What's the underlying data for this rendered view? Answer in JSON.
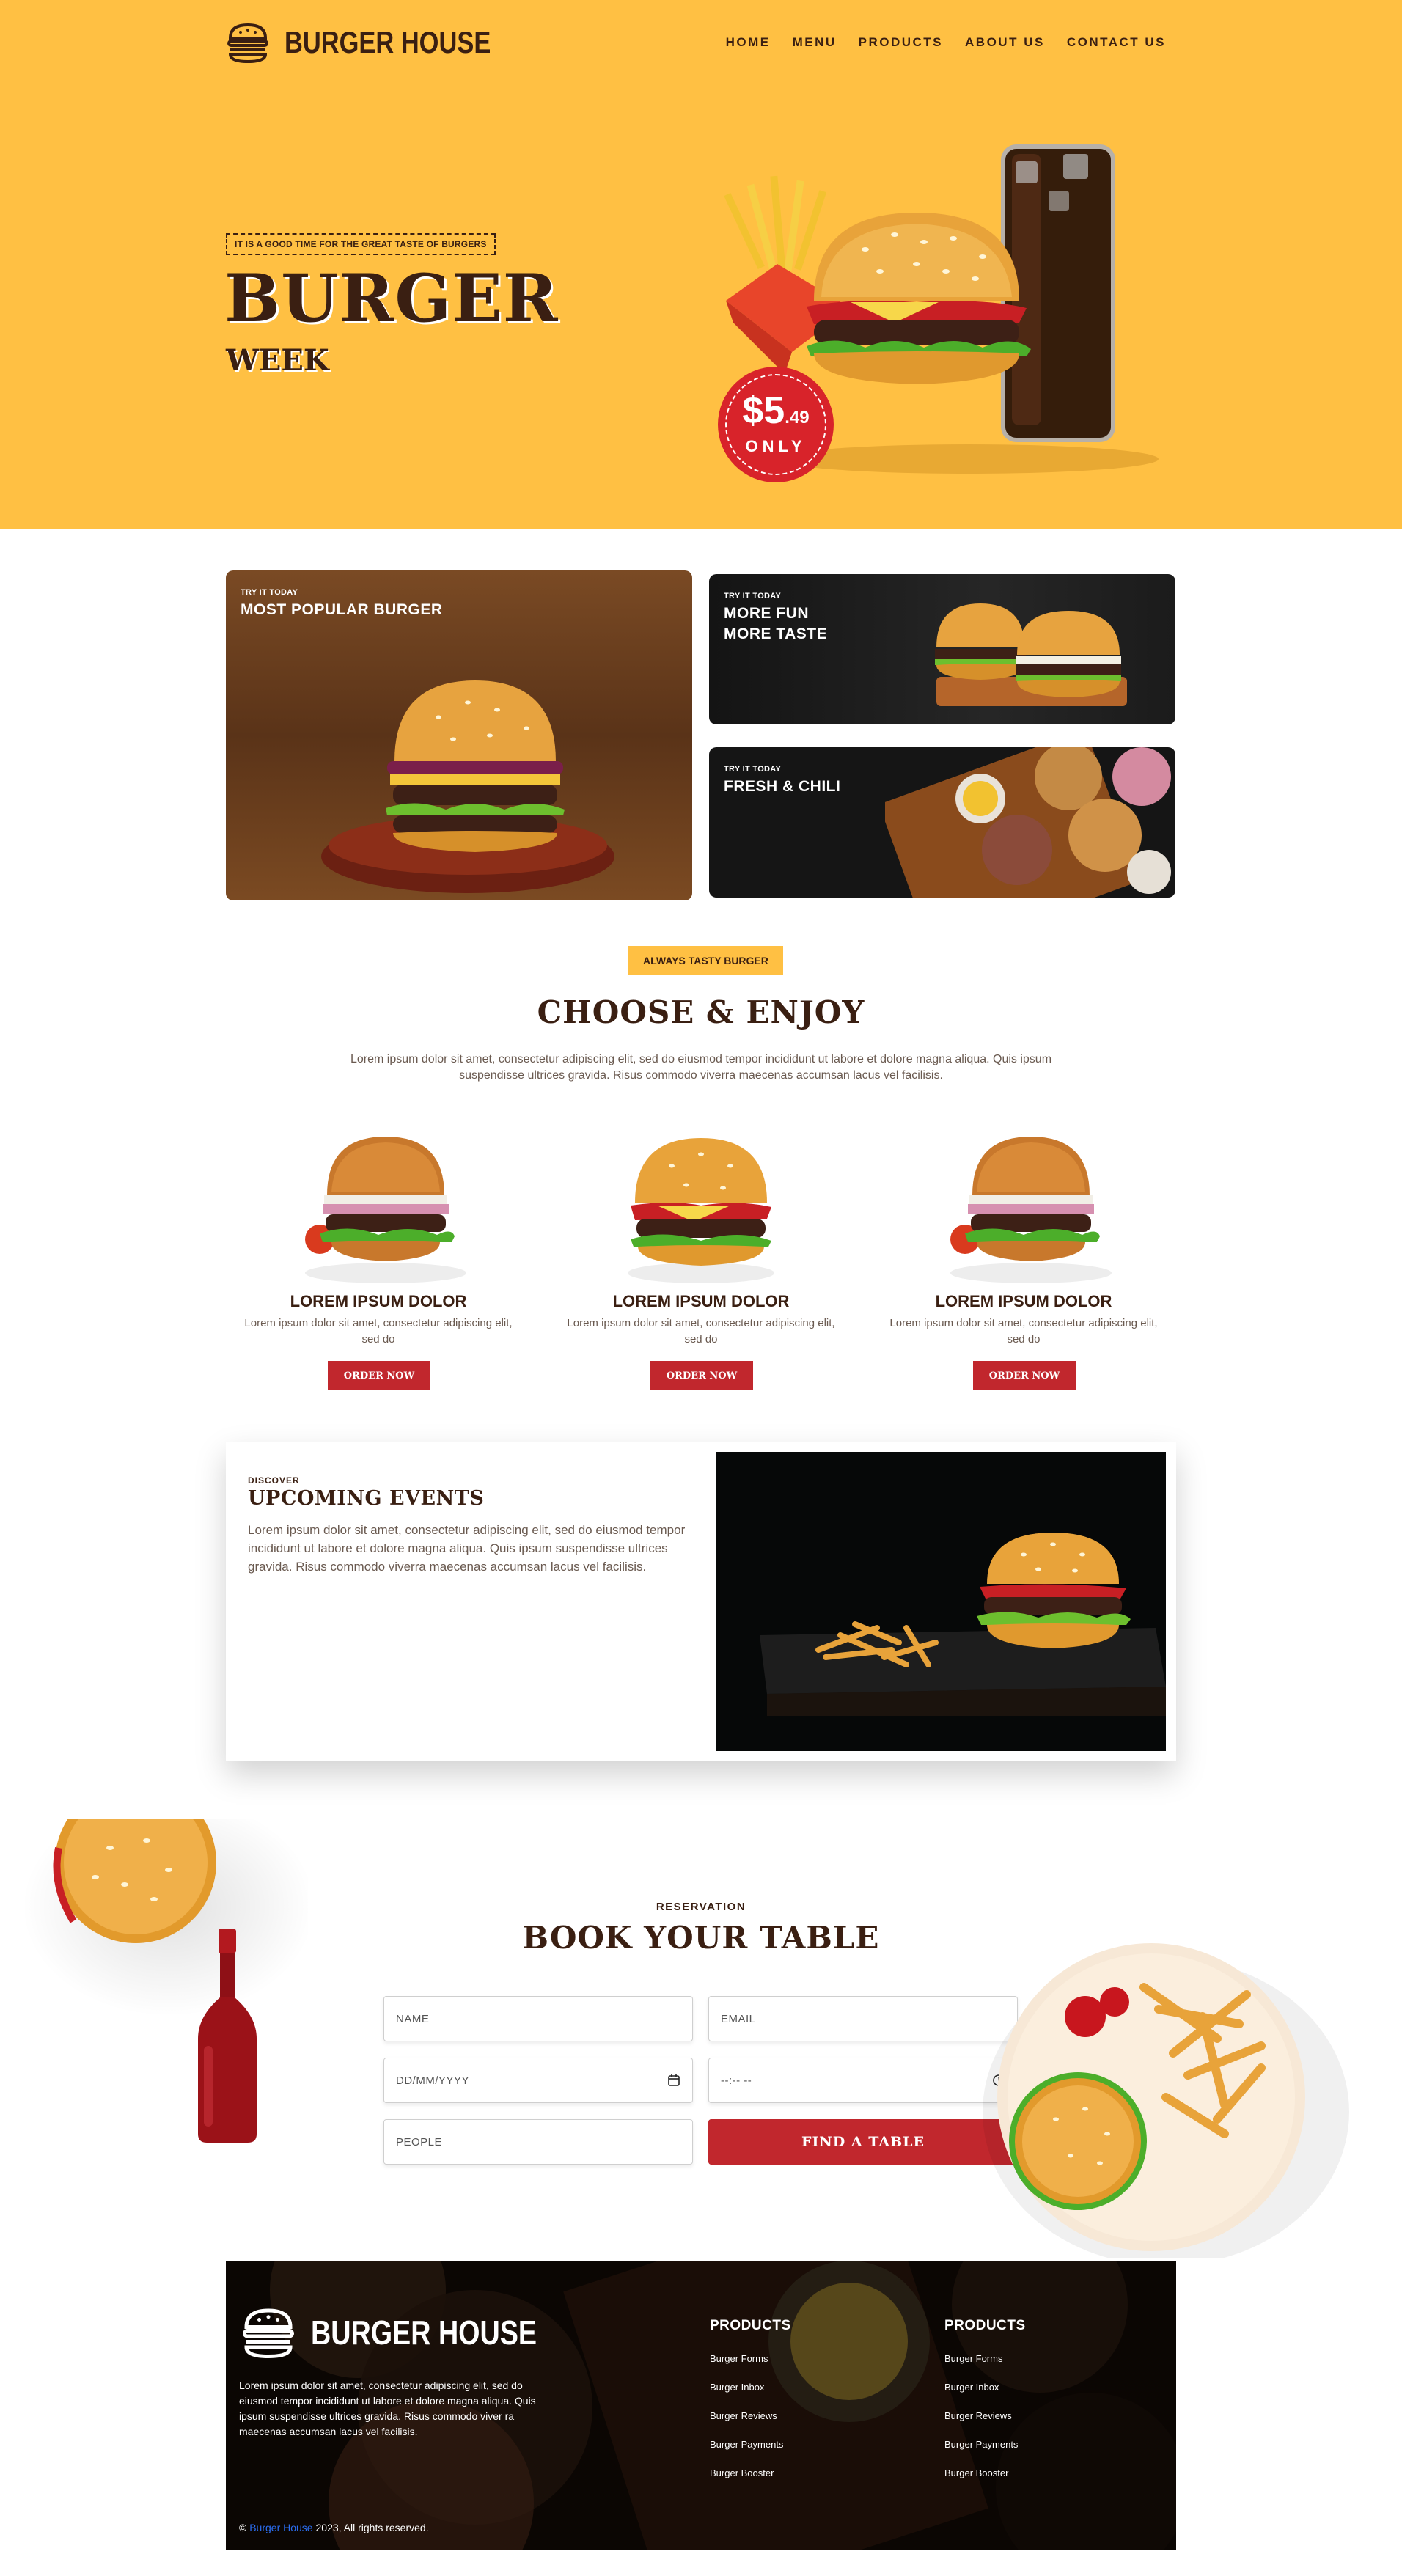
{
  "header": {
    "brand": "BURGER HOUSE",
    "nav": [
      "HOME",
      "MENU",
      "PRODUCTS",
      "ABOUT US",
      "CONTACT US"
    ]
  },
  "hero": {
    "tagline": "IT IS A GOOD TIME FOR THE GREAT TASTE OF BURGERS",
    "title": "BURGER",
    "subtitle": "WEEK",
    "price_main": "$5",
    "price_cents": ".49",
    "price_only": "ONLY"
  },
  "promos": [
    {
      "kicker": "TRY IT TODAY",
      "title": "MOST POPULAR BURGER"
    },
    {
      "kicker": "TRY IT TODAY",
      "title_line1": "MORE FUN",
      "title_line2": "MORE TASTE"
    },
    {
      "kicker": "TRY IT TODAY",
      "title": "FRESH & CHILI"
    }
  ],
  "choose": {
    "pill": "ALWAYS TASTY BURGER",
    "title": "CHOOSE & ENJOY",
    "lead_line1": "Lorem ipsum dolor sit amet, consectetur adipiscing elit, sed do eiusmod tempor incididunt ut labore et dolore magna aliqua. Quis ipsum",
    "lead_line2": "suspendisse ultrices gravida. Risus commodo viverra maecenas accumsan lacus vel facilisis.",
    "items": [
      {
        "name": "LOREM IPSUM DOLOR",
        "desc_line1": "Lorem ipsum dolor sit amet, consectetur adipiscing elit,",
        "desc_line2": "sed do",
        "button": "ORDER NOW"
      },
      {
        "name": "LOREM IPSUM DOLOR",
        "desc_line1": "Lorem ipsum dolor sit amet, consectetur adipiscing elit,",
        "desc_line2": "sed do",
        "button": "ORDER NOW"
      },
      {
        "name": "LOREM IPSUM DOLOR",
        "desc_line1": "Lorem ipsum dolor sit amet, consectetur adipiscing elit,",
        "desc_line2": "sed do",
        "button": "ORDER NOW"
      }
    ]
  },
  "events": {
    "kicker": "DISCOVER",
    "title": "UPCOMING EVENTS",
    "description": "Lorem ipsum dolor sit amet, consectetur adipiscing elit, sed do eiusmod tempor incididunt ut labore et dolore magna aliqua. Quis ipsum suspendisse ultrices gravida. Risus commodo viverra maecenas accumsan lacus vel facilisis."
  },
  "reservation": {
    "kicker": "RESERVATION",
    "title": "BOOK YOUR TABLE",
    "name_placeholder": "NAME",
    "email_placeholder": "EMAIL",
    "date_placeholder": "DD/MM/YYYY",
    "time_placeholder": "--:-- --",
    "people_placeholder": "PEOPLE",
    "button": "FIND A TABLE"
  },
  "footer": {
    "brand": "BURGER HOUSE",
    "description": "Lorem ipsum dolor sit amet, consectetur adipiscing elit, sed do eiusmod tempor incididunt ut labore et dolore magna aliqua. Quis ipsum suspendisse ultrices gravida. Risus commodo viver ra maecenas accumsan lacus vel facilisis.",
    "copyright_prefix": "©",
    "copyright_link": "Burger House",
    "copyright_suffix": "2023, All rights reserved.",
    "col1": {
      "heading": "PRODUCTS",
      "links": [
        "Burger Forms",
        "Burger Inbox",
        "Burger Reviews",
        "Burger Payments",
        "Burger Booster"
      ]
    },
    "col2": {
      "heading": "PRODUCTS",
      "links": [
        "Burger Forms",
        "Burger Inbox",
        "Burger Reviews",
        "Burger Payments",
        "Burger Booster"
      ]
    }
  },
  "colors": {
    "accent": "#ffc043",
    "brand_dark": "#3a1f12",
    "button_red": "#c1272d",
    "badge_red": "#d8232a"
  },
  "icons": [
    "burger-logo-icon",
    "calendar-icon",
    "clock-icon"
  ]
}
